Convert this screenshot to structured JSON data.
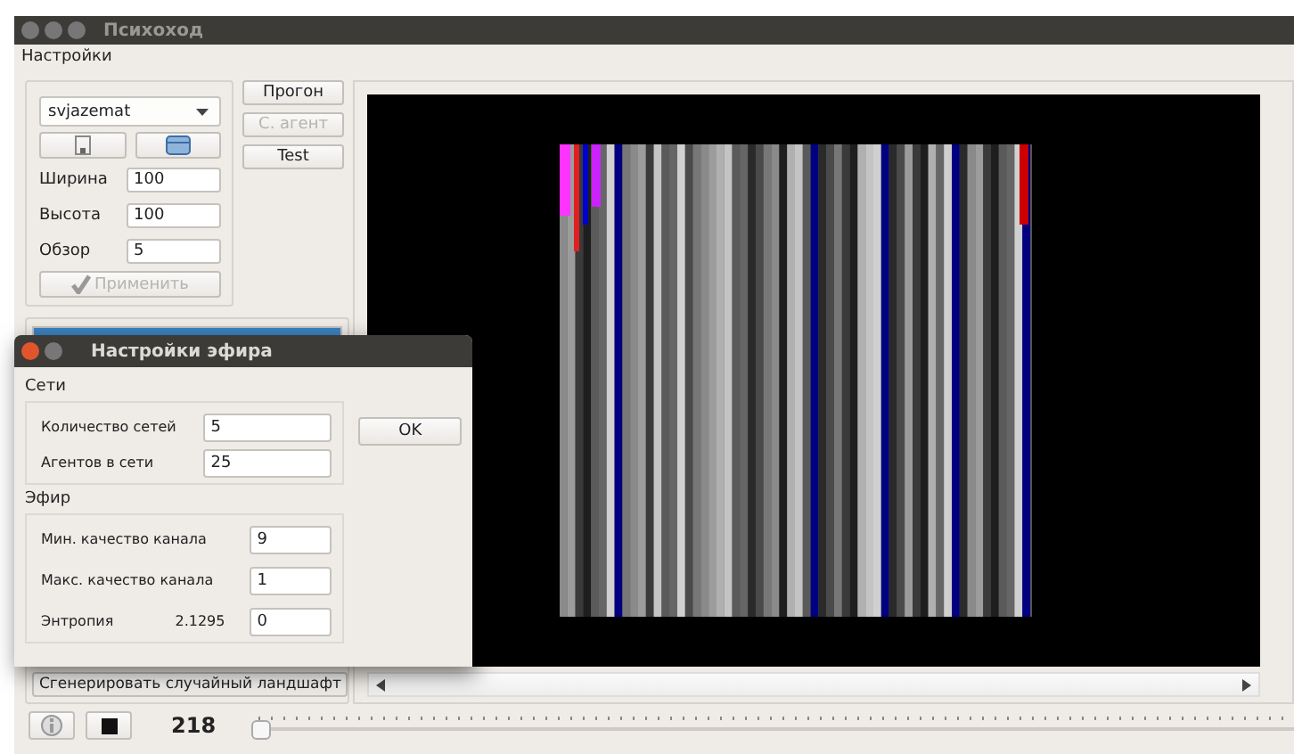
{
  "window": {
    "title": "Психоход"
  },
  "menu": [
    "Настройки"
  ],
  "preset": {
    "value": "svjazemat"
  },
  "fields": [
    {
      "label": "Ширина",
      "value": "100"
    },
    {
      "label": "Высота",
      "value": "100"
    },
    {
      "label": "Обзор",
      "value": "5"
    }
  ],
  "apply_button": {
    "label": "Применить",
    "disabled": true
  },
  "side_buttons": [
    {
      "label": "Прогон",
      "disabled": false
    },
    {
      "label": "С. агент",
      "disabled": true
    },
    {
      "label": "Test",
      "disabled": false
    }
  ],
  "list": [
    {
      "selected": true
    }
  ],
  "generate_button": "Сгенерировать случайный ландшафт",
  "step": "218",
  "timeline": {
    "level": 0
  },
  "dialog": {
    "title": "Настройки эфира",
    "ok": "OK",
    "sections": [
      {
        "title": "Сети",
        "fields": [
          {
            "label": "Количество сетей",
            "value": "5"
          },
          {
            "label": "Агентов в сети",
            "value": "25"
          }
        ]
      },
      {
        "title": "Эфир",
        "fields": [
          {
            "label": "Мин. качество канала",
            "value": "9"
          },
          {
            "label": "Макс. качество канала",
            "value": "1"
          },
          {
            "label": "Энтропия",
            "reading": "2.1295",
            "value": "0"
          }
        ]
      }
    ]
  }
}
